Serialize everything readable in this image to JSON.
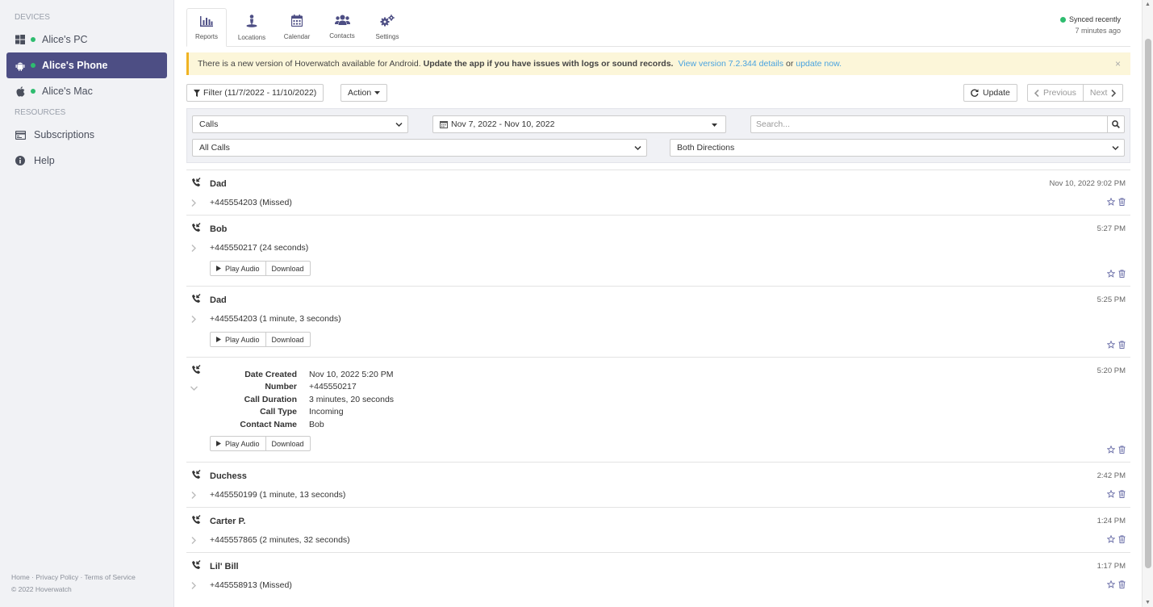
{
  "sidebar": {
    "devices_header": "DEVICES",
    "devices": [
      {
        "label": "Alice's PC",
        "icon": "windows-icon",
        "status_color": "#2ebc6f"
      },
      {
        "label": "Alice's Phone",
        "icon": "android-icon",
        "status_color": "#2ebc6f"
      },
      {
        "label": "Alice's Mac",
        "icon": "apple-icon",
        "status_color": "#2ebc6f"
      }
    ],
    "resources_header": "RESOURCES",
    "resources": [
      {
        "label": "Subscriptions",
        "icon": "subscriptions-icon"
      },
      {
        "label": "Help",
        "icon": "info-icon"
      }
    ],
    "footer_links": "Home · Privacy Policy · Terms of Service",
    "footer_copyright": "© 2022 Hoverwatch"
  },
  "tabs": [
    {
      "label": "Reports",
      "icon": "bar-chart-icon"
    },
    {
      "label": "Locations",
      "icon": "location-icon"
    },
    {
      "label": "Calendar",
      "icon": "calendar-icon"
    },
    {
      "label": "Contacts",
      "icon": "contacts-icon"
    },
    {
      "label": "Settings",
      "icon": "cogs-icon"
    }
  ],
  "sync": {
    "status": "Synced recently",
    "time": "7 minutes ago"
  },
  "banner": {
    "text1": "There is a new version of Hoverwatch available for Android.",
    "bold": "Update the app if you have issues with logs or sound records.",
    "link1": "View version 7.2.344 details",
    "or": "or",
    "link2": "update now.",
    "close": "×"
  },
  "toolbar": {
    "filter_label": "Filter (11/7/2022 - 11/10/2022)",
    "action_label": "Action",
    "update_label": "Update",
    "previous_label": "Previous",
    "next_label": "Next"
  },
  "filters": {
    "type_value": "Calls",
    "date_value": "Nov 7, 2022 - Nov 10, 2022",
    "search_placeholder": "Search...",
    "call_filter_value": "All Calls",
    "direction_value": "Both Directions"
  },
  "calls": [
    {
      "name": "Dad",
      "detail": "+445554203 (Missed)",
      "time": "Nov 10, 2022 9:02 PM"
    },
    {
      "name": "Bob",
      "detail": "+445550217 (24 seconds)",
      "time": "5:27 PM"
    },
    {
      "name": "Dad",
      "detail": "+445554203 (1 minute, 3 seconds)",
      "time": "5:25 PM"
    },
    {
      "name": "",
      "detail": "",
      "time": "5:20 PM"
    },
    {
      "name": "Duchess",
      "detail": "+445550199 (1 minute, 13 seconds)",
      "time": "2:42 PM"
    },
    {
      "name": "Carter P.",
      "detail": "+445557865 (2 minutes, 32 seconds)",
      "time": "1:24 PM"
    },
    {
      "name": "Lil' Bill",
      "detail": "+445558913 (Missed)",
      "time": "1:17 PM"
    }
  ],
  "expanded": {
    "rows": [
      {
        "key": "Date Created",
        "value": "Nov 10, 2022 5:20 PM"
      },
      {
        "key": "Number",
        "value": "+445550217"
      },
      {
        "key": "Call Duration",
        "value": "3 minutes, 20 seconds"
      },
      {
        "key": "Call Type",
        "value": "Incoming"
      },
      {
        "key": "Contact Name",
        "value": "Bob"
      }
    ]
  },
  "audio": {
    "play_label": "Play Audio",
    "download_label": "Download"
  }
}
